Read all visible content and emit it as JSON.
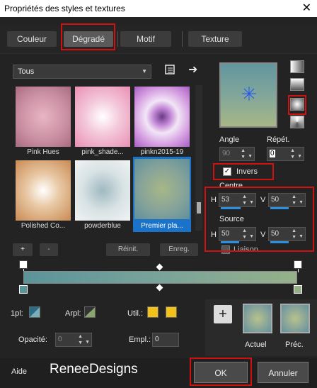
{
  "window": {
    "title": "Propriétés des styles et textures",
    "close_icon": "close-icon"
  },
  "tabs": [
    {
      "label": "Couleur"
    },
    {
      "label": "Dégradé"
    },
    {
      "label": "Motif"
    },
    {
      "label": "Texture"
    }
  ],
  "library": {
    "category": "Tous",
    "items": [
      {
        "label": "Pink Hues"
      },
      {
        "label": "pink_shade..."
      },
      {
        "label": "pinkn2015-19"
      },
      {
        "label": "Polished Co..."
      },
      {
        "label": "powderblue"
      },
      {
        "label": "Premier pla..."
      }
    ],
    "buttons": {
      "add": "+",
      "remove": "-",
      "reset": "Réinit.",
      "save": "Enreg."
    }
  },
  "gradient": {
    "angle_label": "Angle",
    "angle_value": "90",
    "repeat_label": "Répét.",
    "repeat_value": "0",
    "invert_label": "Invers",
    "invert_checked": true,
    "center_label": "Centre",
    "center_h_label": "H",
    "center_h": "53",
    "center_v_label": "V",
    "center_v": "50",
    "source_label": "Source",
    "source_h_label": "H",
    "source_h": "50",
    "source_v_label": "V",
    "source_v": "50",
    "link_label": "Liaison",
    "colors": [
      "#5b9499",
      "#96b18a"
    ]
  },
  "stops": {
    "opacity_1pl_label": "1pl:",
    "arpl_label": "Arpl:",
    "util_label": "Util.:",
    "util_colors": [
      "#f2c21b",
      "#f2c21b"
    ],
    "opacity_label": "Opacité:",
    "opacity_value": "0",
    "empl_label": "Empl.:",
    "empl_value": "0"
  },
  "samples": {
    "current_label": "Actuel",
    "previous_label": "Préc.",
    "add": "+"
  },
  "footer": {
    "help": "Aide",
    "watermark": "ReneeDesigns",
    "ok": "OK",
    "cancel": "Annuler"
  }
}
